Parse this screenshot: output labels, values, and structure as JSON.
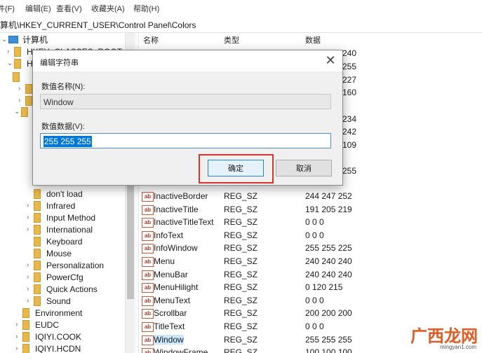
{
  "menu": [
    "件(F)",
    "编辑(E)",
    "查看(V)",
    "收藏夹(A)",
    "帮助(H)"
  ],
  "address": "算机\\HKEY_CURRENT_USER\\Control Panel\\Colors",
  "tree": {
    "root": "计算机",
    "partial": [
      "HKEY_CLASSES_ROOT",
      "H"
    ],
    "items": [
      "don't load",
      "Infrared",
      "Input Method",
      "International",
      "Keyboard",
      "Mouse",
      "Personalization",
      "PowerCfg",
      "Quick Actions",
      "Sound"
    ],
    "top_items": [
      "Environment",
      "EUDC",
      "IQIYI.COOK",
      "IQIYI.HCDN"
    ]
  },
  "list": {
    "headers": {
      "name": "名称",
      "type": "类型",
      "data": "数据"
    },
    "partial_right_values": [
      "240",
      "255",
      "227",
      "160",
      "234",
      "242",
      "109",
      "255"
    ],
    "rows": [
      {
        "name": "InactiveBorder",
        "type": "REG_SZ",
        "data": "244 247 252"
      },
      {
        "name": "InactiveTitle",
        "type": "REG_SZ",
        "data": "191 205 219"
      },
      {
        "name": "InactiveTitleText",
        "type": "REG_SZ",
        "data": "0 0 0"
      },
      {
        "name": "InfoText",
        "type": "REG_SZ",
        "data": "0 0 0"
      },
      {
        "name": "InfoWindow",
        "type": "REG_SZ",
        "data": "255 255 225"
      },
      {
        "name": "Menu",
        "type": "REG_SZ",
        "data": "240 240 240"
      },
      {
        "name": "MenuBar",
        "type": "REG_SZ",
        "data": "240 240 240"
      },
      {
        "name": "MenuHilight",
        "type": "REG_SZ",
        "data": "0 120 215"
      },
      {
        "name": "MenuText",
        "type": "REG_SZ",
        "data": "0 0 0"
      },
      {
        "name": "Scrollbar",
        "type": "REG_SZ",
        "data": "200 200 200"
      },
      {
        "name": "TitleText",
        "type": "REG_SZ",
        "data": "0 0 0"
      },
      {
        "name": "Window",
        "type": "REG_SZ",
        "data": "255 255 255"
      },
      {
        "name": "WindowFrame",
        "type": "REG_SZ",
        "data": "100 100 100"
      }
    ]
  },
  "dialog": {
    "title": "编辑字符串",
    "name_label": "数值名称(N):",
    "name_value": "Window",
    "data_label": "数值数据(V):",
    "data_value": "255 255 255",
    "ok_label": "确定",
    "cancel_label": "取消",
    "close_glyph": "✕"
  },
  "watermark": {
    "title": "广西龙网",
    "url": "mingyan1.com"
  },
  "icons": {
    "tree_caret": "chevron-right-icon",
    "folder": "folder-icon",
    "value": "string-value-icon"
  }
}
